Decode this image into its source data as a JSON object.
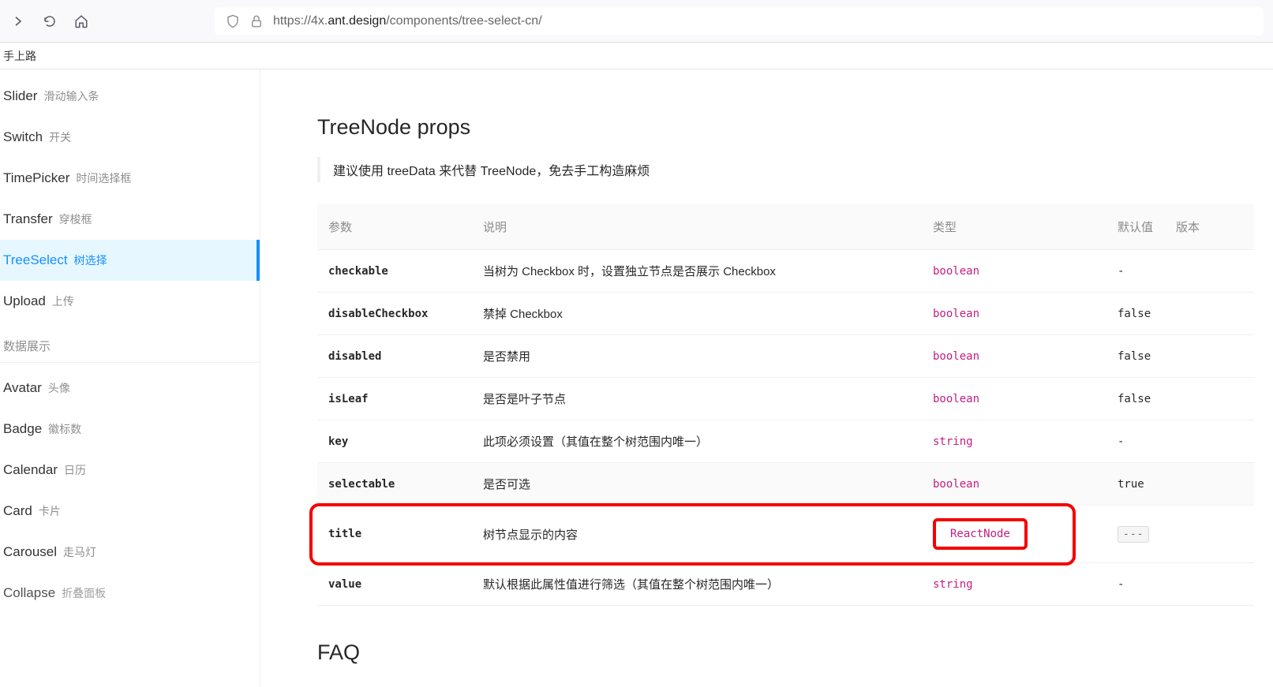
{
  "browser": {
    "url_prefix": "https://4x.",
    "url_domain": "ant.design",
    "url_path": "/components/tree-select-cn/"
  },
  "bookmarks": [
    "手上路"
  ],
  "sidebar": {
    "items": [
      {
        "en": "Slider",
        "cn": "滑动输入条"
      },
      {
        "en": "Switch",
        "cn": "开关"
      },
      {
        "en": "TimePicker",
        "cn": "时间选择框"
      },
      {
        "en": "Transfer",
        "cn": "穿梭框"
      },
      {
        "en": "TreeSelect",
        "cn": "树选择",
        "active": true
      },
      {
        "en": "Upload",
        "cn": "上传"
      }
    ],
    "group_title": "数据展示",
    "group_items": [
      {
        "en": "Avatar",
        "cn": "头像"
      },
      {
        "en": "Badge",
        "cn": "徽标数"
      },
      {
        "en": "Calendar",
        "cn": "日历"
      },
      {
        "en": "Card",
        "cn": "卡片"
      },
      {
        "en": "Carousel",
        "cn": "走马灯"
      },
      {
        "en": "Collapse",
        "cn": "折叠面板"
      }
    ]
  },
  "content": {
    "heading": "TreeNode props",
    "note": "建议使用 treeData 来代替 TreeNode，免去手工构造麻烦",
    "columns": [
      "参数",
      "说明",
      "类型",
      "默认值",
      "版本"
    ],
    "rows": [
      {
        "param": "checkable",
        "desc": "当树为 Checkbox 时，设置独立节点是否展示 Checkbox",
        "type": "boolean",
        "def": "-"
      },
      {
        "param": "disableCheckbox",
        "desc": "禁掉 Checkbox",
        "type": "boolean",
        "def": "false"
      },
      {
        "param": "disabled",
        "desc": "是否禁用",
        "type": "boolean",
        "def": "false"
      },
      {
        "param": "isLeaf",
        "desc": "是否是叶子节点",
        "type": "boolean",
        "def": "false"
      },
      {
        "param": "key",
        "desc": "此项必须设置（其值在整个树范围内唯一）",
        "type": "string",
        "def": "-"
      },
      {
        "param": "selectable",
        "desc": "是否可选",
        "type": "boolean",
        "def": "true"
      },
      {
        "param": "title",
        "desc": "树节点显示的内容",
        "type": "ReactNode",
        "def": "---",
        "highlight": true
      },
      {
        "param": "value",
        "desc": "默认根据此属性值进行筛选（其值在整个树范围内唯一）",
        "type": "string",
        "def": "-"
      }
    ],
    "faq_heading": "FAQ"
  }
}
